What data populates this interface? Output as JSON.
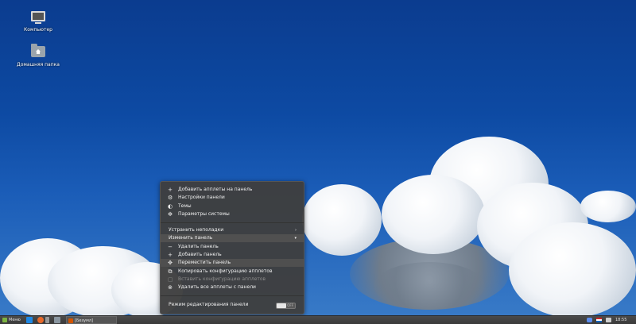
{
  "desktop": {
    "icons": [
      {
        "label": "Компьютер",
        "icon": "computer-icon"
      },
      {
        "label": "Домашняя папка",
        "icon": "home-folder-icon"
      }
    ]
  },
  "context_menu": {
    "items_top": [
      {
        "label": "Добавить апплеты на панель",
        "icon": "plus-icon"
      },
      {
        "label": "Настройки панели",
        "icon": "gear-icon"
      },
      {
        "label": "Темы",
        "icon": "theme-icon"
      },
      {
        "label": "Параметры системы",
        "icon": "settings-icon"
      }
    ],
    "troubleshoot": {
      "label": "Устранить неполадки",
      "arrow": "›"
    },
    "edit_panel": {
      "label": "Изменить панель",
      "arrow": "▾"
    },
    "edit_items": [
      {
        "label": "Удалить панель",
        "icon": "minus-icon",
        "disabled": false
      },
      {
        "label": "Добавить панель",
        "icon": "plus-icon",
        "disabled": false
      },
      {
        "label": "Переместить панель",
        "icon": "move-icon",
        "disabled": false
      },
      {
        "label": "Копировать конфигурацию апплетов",
        "icon": "copy-icon",
        "disabled": false
      },
      {
        "label": "Вставить конфигурацию апплетов",
        "icon": "paste-icon",
        "disabled": true
      },
      {
        "label": "Удалить все апплеты с панели",
        "icon": "clear-icon",
        "disabled": false
      }
    ],
    "edit_mode": {
      "label": "Режим редактирования панели",
      "toggle_label": "OFF",
      "enabled": false
    }
  },
  "panel": {
    "menu_label": "Меню",
    "task_label": "[Безумл]",
    "clock": "18:55",
    "colors": {
      "menu_icon": "#7cb342",
      "task_icon": "#d35400"
    }
  }
}
